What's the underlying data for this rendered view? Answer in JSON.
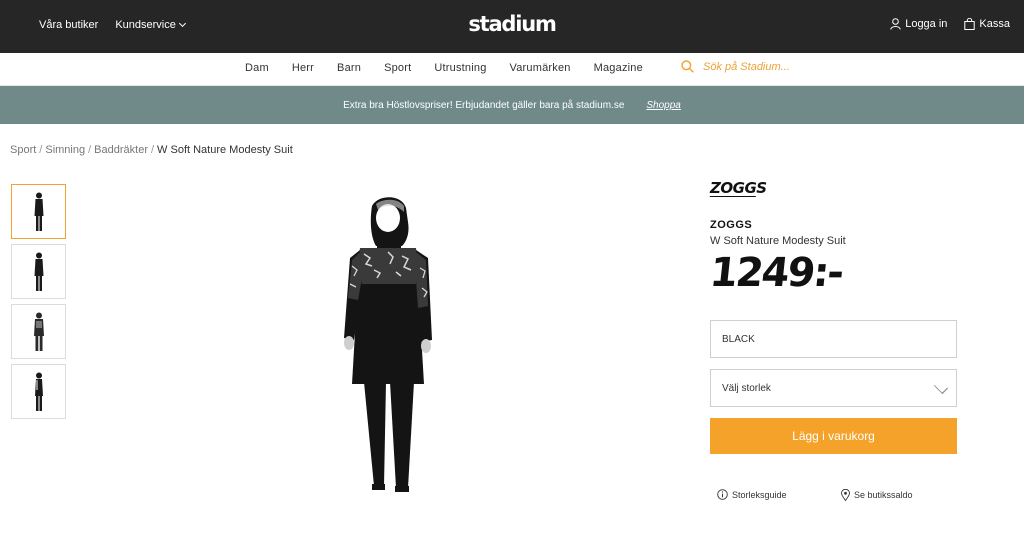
{
  "topbar": {
    "stores": "Våra butiker",
    "service": "Kundservice",
    "logo": "stadium",
    "login": "Logga in",
    "cart": "Kassa"
  },
  "nav": {
    "items": [
      "Dam",
      "Herr",
      "Barn",
      "Sport",
      "Utrustning",
      "Varumärken",
      "Magazine"
    ],
    "search_placeholder": "Sök på Stadium..."
  },
  "promo": {
    "text": "Extra bra Höstlovspriser! Erbjudandet gäller bara på stadium.se",
    "link": "Shoppa"
  },
  "breadcrumb": {
    "items": [
      "Sport",
      "Simning",
      "Baddräkter"
    ],
    "current": "W Soft Nature Modesty Suit"
  },
  "product": {
    "brand_logo": "ZOGGS",
    "brand": "ZOGGS",
    "name": "W Soft Nature Modesty Suit",
    "price": "1249:-",
    "color_value": "BLACK",
    "size_placeholder": "Välj storlek",
    "add_to_cart": "Lägg i varukorg",
    "size_guide": "Storleksguide",
    "store_stock": "Se butikssaldo"
  },
  "colors": {
    "topbar_bg": "#262626",
    "accent": "#f5a22a",
    "promo_bg": "#6f8a89"
  }
}
